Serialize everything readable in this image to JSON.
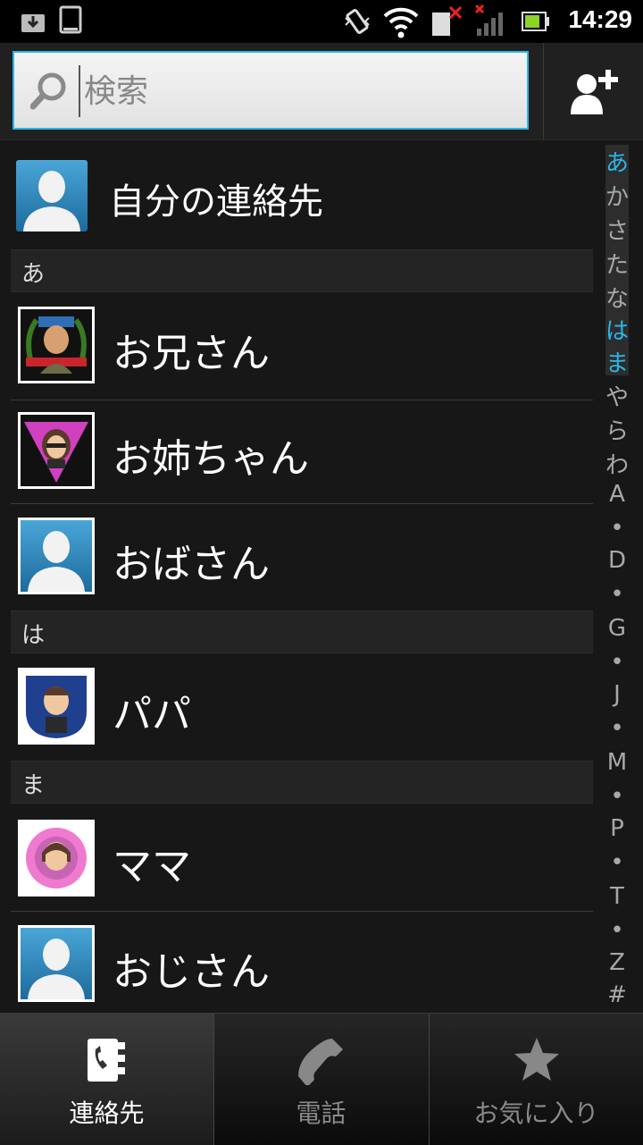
{
  "status_bar": {
    "time": "14:29",
    "icons": [
      "download-icon",
      "phone-outline-icon",
      "vibrate-icon",
      "wifi-icon",
      "sim-missing-icon",
      "signal-none-icon",
      "battery-icon"
    ]
  },
  "search": {
    "placeholder": "検索"
  },
  "my_contact": {
    "label": "自分の連絡先"
  },
  "sections": [
    {
      "header": "あ",
      "contacts": [
        {
          "name": "お兄さん",
          "avatar": "photo-badge-red"
        },
        {
          "name": "お姉ちゃん",
          "avatar": "photo-badge-pink"
        },
        {
          "name": "おばさん",
          "avatar": "default"
        }
      ]
    },
    {
      "header": "は",
      "contacts": [
        {
          "name": "パパ",
          "avatar": "photo-badge-blue"
        }
      ]
    },
    {
      "header": "ま",
      "contacts": [
        {
          "name": "ママ",
          "avatar": "photo-flower"
        },
        {
          "name": "おじさん",
          "avatar": "default"
        }
      ]
    }
  ],
  "index_bar": [
    "あ",
    "か",
    "さ",
    "た",
    "な",
    "は",
    "ま",
    "や",
    "ら",
    "わ",
    "A",
    "•",
    "D",
    "•",
    "G",
    "•",
    "J",
    "•",
    "M",
    "•",
    "P",
    "•",
    "T",
    "•",
    "Z",
    "#"
  ],
  "index_highlighted": [
    "あ",
    "は",
    "ま"
  ],
  "tabs": [
    {
      "label": "連絡先",
      "active": true
    },
    {
      "label": "電話",
      "active": false
    },
    {
      "label": "お気に入り",
      "active": false
    }
  ],
  "colors": {
    "accent": "#2db6e6",
    "background": "#171717",
    "tab_inactive_text": "#8a8a8a"
  }
}
